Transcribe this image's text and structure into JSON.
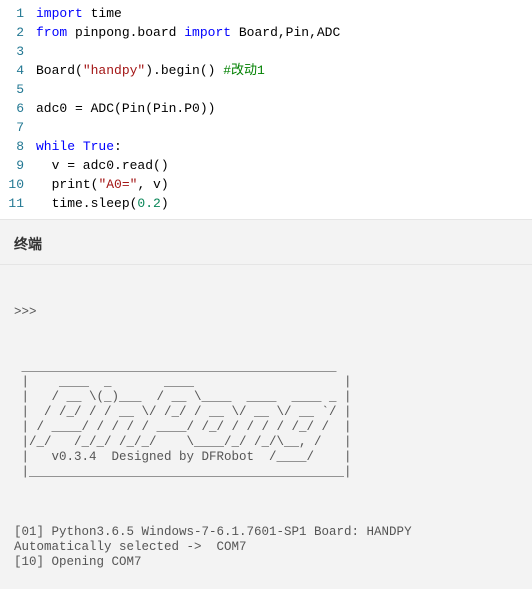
{
  "editor": {
    "lines": [
      {
        "num": "1",
        "tokens": [
          [
            "kw",
            "import"
          ],
          [
            "",
            " "
          ],
          [
            "",
            "time"
          ]
        ]
      },
      {
        "num": "2",
        "tokens": [
          [
            "kw",
            "from"
          ],
          [
            "",
            " pinpong.board "
          ],
          [
            "kw",
            "import"
          ],
          [
            "",
            " Board,Pin,ADC"
          ]
        ]
      },
      {
        "num": "3",
        "tokens": [
          [
            "",
            ""
          ]
        ]
      },
      {
        "num": "4",
        "tokens": [
          [
            "",
            "Board("
          ],
          [
            "str",
            "\"handpy\""
          ],
          [
            "",
            ").begin() "
          ],
          [
            "cmt",
            "#改动1"
          ]
        ]
      },
      {
        "num": "5",
        "tokens": [
          [
            "",
            ""
          ]
        ]
      },
      {
        "num": "6",
        "tokens": [
          [
            "",
            "adc0 = ADC(Pin(Pin.P0))"
          ]
        ]
      },
      {
        "num": "7",
        "tokens": [
          [
            "",
            ""
          ]
        ]
      },
      {
        "num": "8",
        "tokens": [
          [
            "kw",
            "while"
          ],
          [
            "",
            " "
          ],
          [
            "bool",
            "True"
          ],
          [
            "",
            ":"
          ]
        ]
      },
      {
        "num": "9",
        "tokens": [
          [
            "",
            "  v = adc0.read()"
          ]
        ]
      },
      {
        "num": "10",
        "tokens": [
          [
            "",
            "  "
          ],
          [
            "fn",
            "print"
          ],
          [
            "",
            "("
          ],
          [
            "str",
            "\"A0=\""
          ],
          [
            "",
            ", v)"
          ]
        ]
      },
      {
        "num": "11",
        "tokens": [
          [
            "",
            "  time.sleep("
          ],
          [
            "num",
            "0.2"
          ],
          [
            "",
            ")"
          ]
        ]
      }
    ]
  },
  "terminal": {
    "title": "终端",
    "prompt": ">>>",
    "ascii": " __________________________________________\n |    ____  _       ____                    |\n |   / __ \\(_)___  / __ \\____  ____  ____ _ |\n |  / /_/ / / __ \\/ /_/ / __ \\/ __ \\/ __ `/ |\n | / ____/ / / / / ____/ /_/ / / / / /_/ /  |\n |/_/   /_/_/ /_/_/    \\____/_/ /_/\\__, /   |\n |   v0.3.4  Designed by DFRobot  /____/    |\n |__________________________________________|\n",
    "lines": [
      "[01] Python3.6.5 Windows-7-6.1.7601-SP1 Board: HANDPY",
      "Automatically selected ->  COM7",
      "[10] Opening COM7"
    ]
  }
}
